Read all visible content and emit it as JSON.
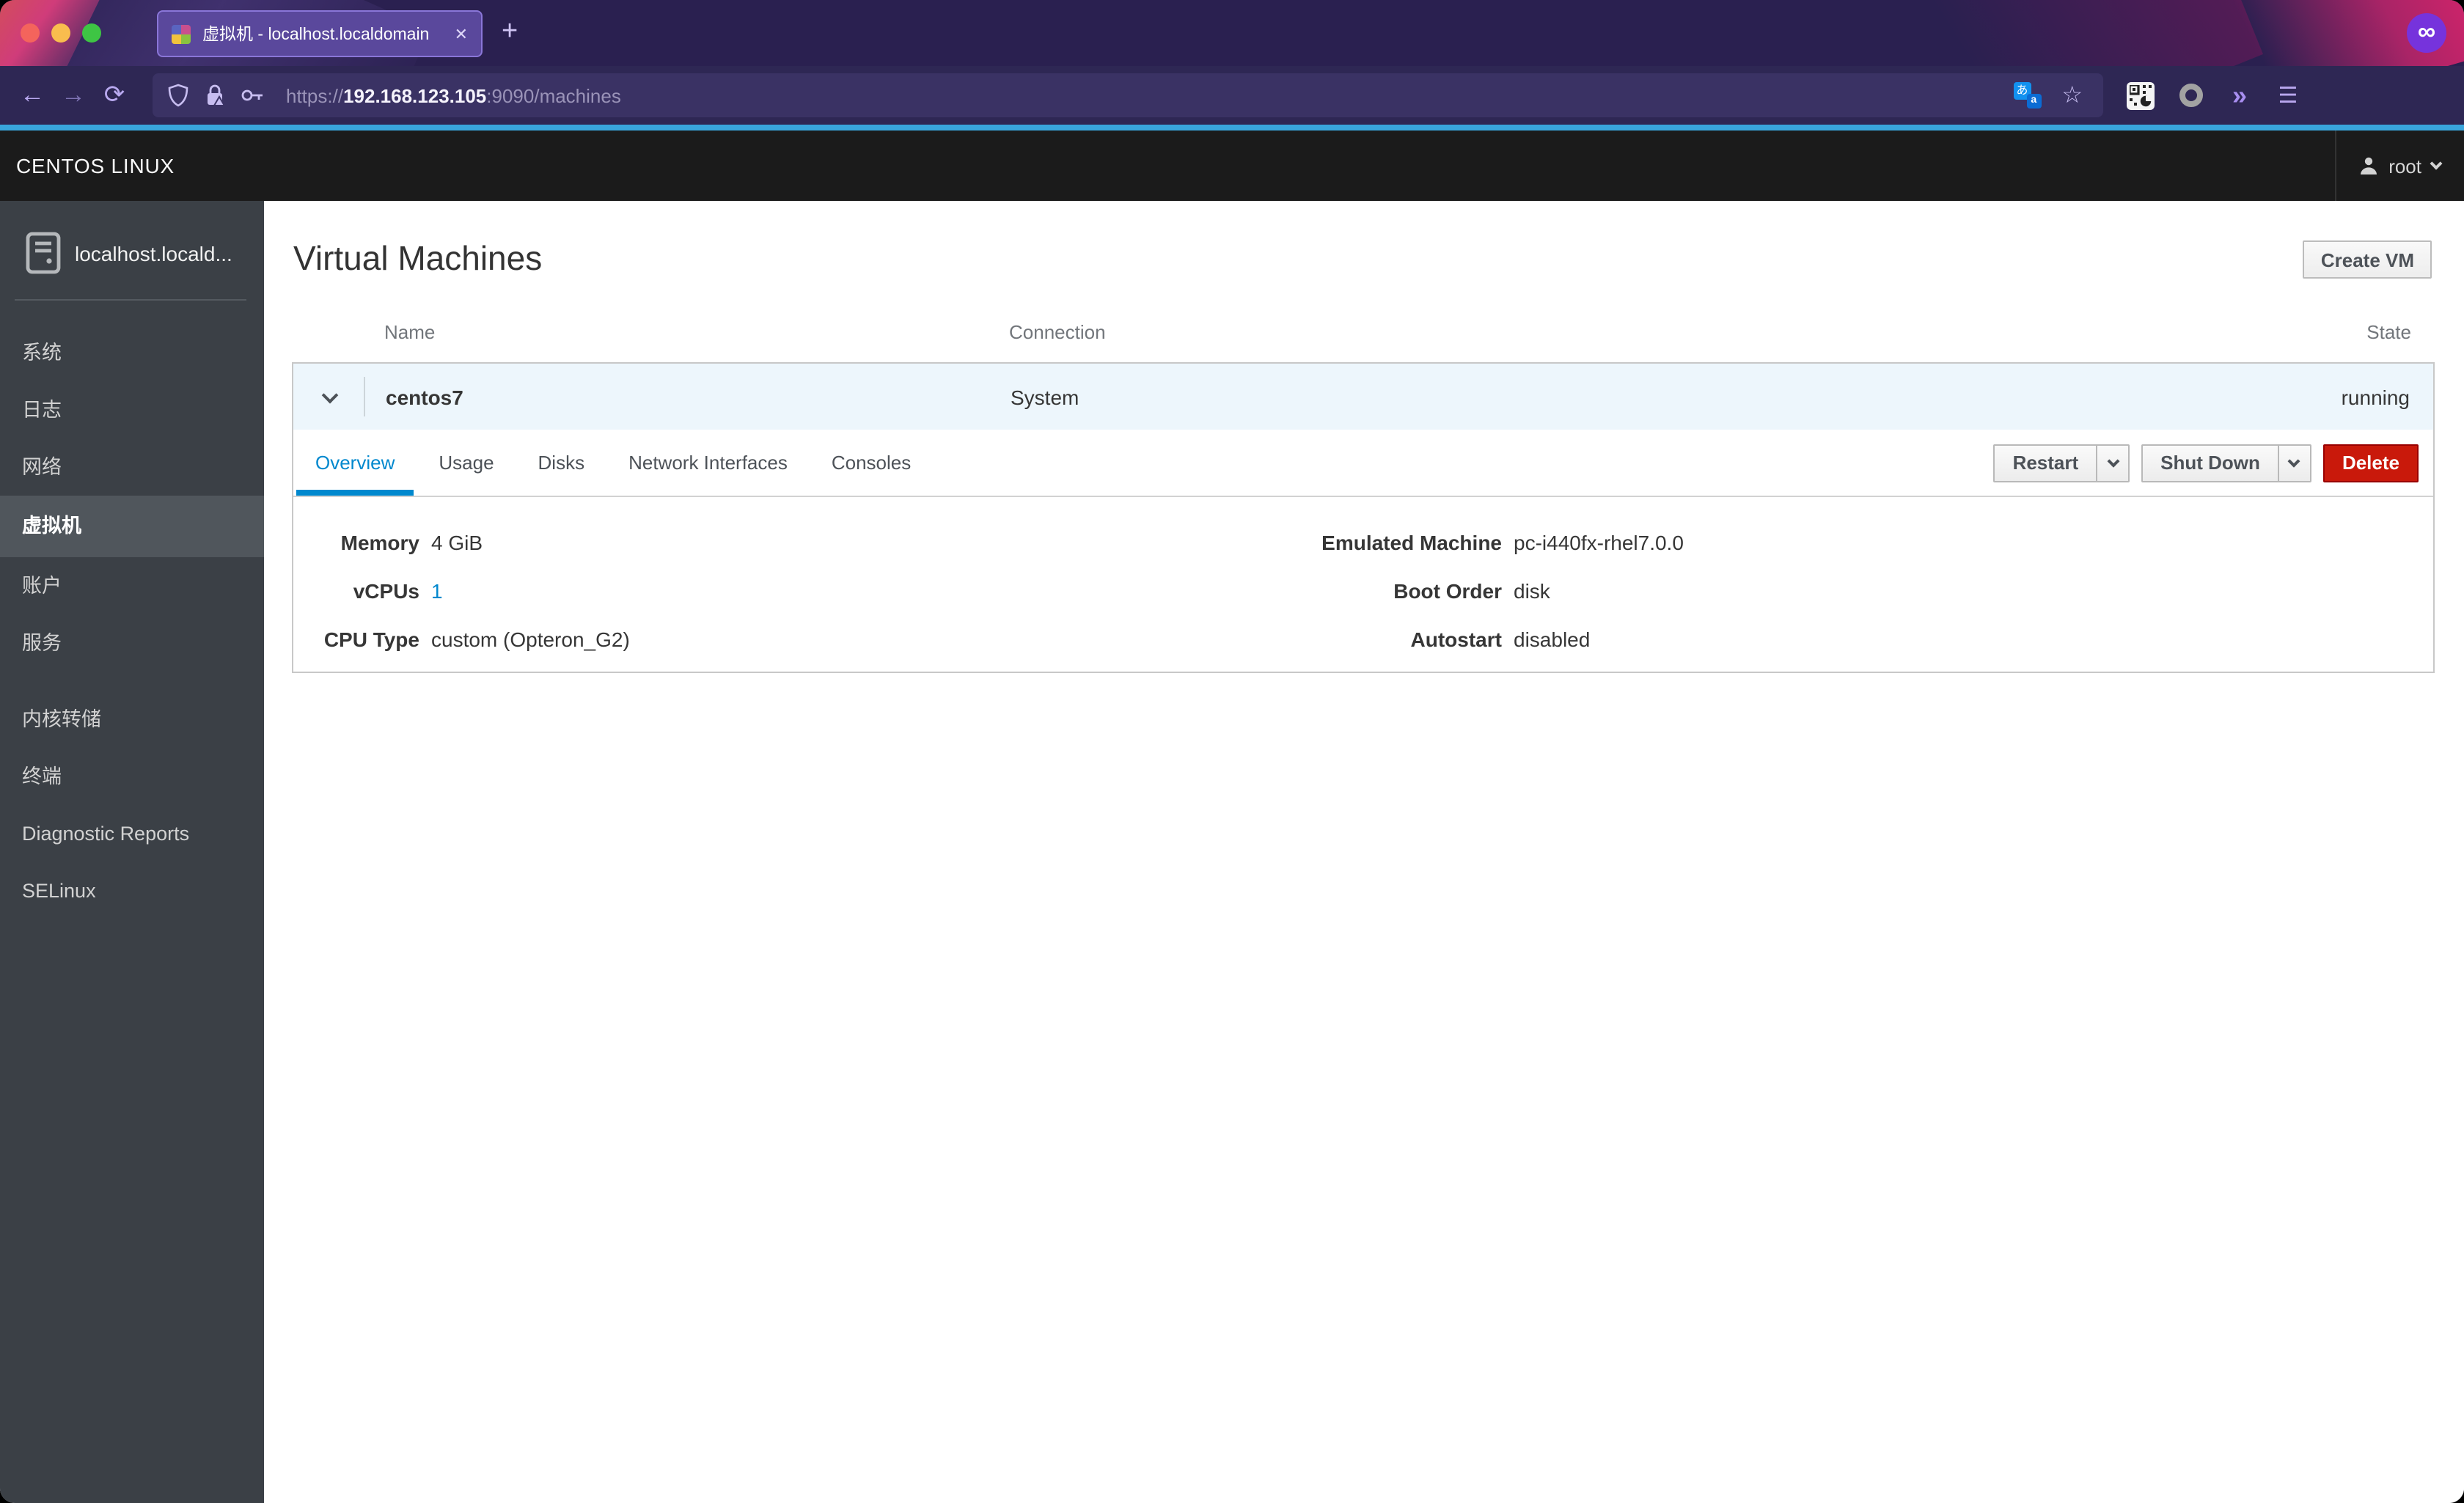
{
  "colors": {
    "accent": "#0088ce",
    "danger": "#c9190b",
    "container_accent": "#39a5dc",
    "active_tab_purple": "#5a489c"
  },
  "browser": {
    "tab": {
      "title": "虚拟机 - localhost.localdomain",
      "close_glyph": "✕"
    },
    "new_tab_glyph": "+",
    "nav": {
      "back_glyph": "←",
      "forward_glyph": "→",
      "reload_glyph": "⟳"
    },
    "url": {
      "scheme": "https://",
      "host": "192.168.123.105",
      "path": ":9090/machines"
    },
    "toolbar": {
      "translate_a": "あ",
      "translate_b": "a",
      "star_glyph": "☆",
      "overflow_glyph": "»",
      "menu_glyph": "☰",
      "private_glyph": "∞"
    }
  },
  "masthead": {
    "brand": "CENTOS LINUX",
    "user": "root"
  },
  "sidebar": {
    "host": "localhost.locald...",
    "items": [
      {
        "label": "系统"
      },
      {
        "label": "日志"
      },
      {
        "label": "网络"
      },
      {
        "label": "虚拟机"
      },
      {
        "label": "账户"
      },
      {
        "label": "服务"
      },
      {
        "label": "内核转储"
      },
      {
        "label": "终端"
      },
      {
        "label": "Diagnostic Reports"
      },
      {
        "label": "SELinux"
      }
    ]
  },
  "page": {
    "title": "Virtual Machines",
    "create_vm_label": "Create VM",
    "table_headers": {
      "name": "Name",
      "connection": "Connection",
      "state": "State"
    },
    "vm": {
      "name": "centos7",
      "connection": "System",
      "state": "running"
    },
    "tabs": [
      {
        "label": "Overview"
      },
      {
        "label": "Usage"
      },
      {
        "label": "Disks"
      },
      {
        "label": "Network Interfaces"
      },
      {
        "label": "Consoles"
      }
    ],
    "actions": {
      "restart": "Restart",
      "shutdown": "Shut Down",
      "delete": "Delete"
    },
    "details": {
      "left": [
        {
          "label": "Memory",
          "value": "4 GiB"
        },
        {
          "label": "vCPUs",
          "value": "1"
        },
        {
          "label": "CPU Type",
          "value": "custom (Opteron_G2)"
        }
      ],
      "right": [
        {
          "label": "Emulated Machine",
          "value": "pc-i440fx-rhel7.0.0"
        },
        {
          "label": "Boot Order",
          "value": "disk"
        },
        {
          "label": "Autostart",
          "value": "disabled"
        }
      ]
    }
  }
}
